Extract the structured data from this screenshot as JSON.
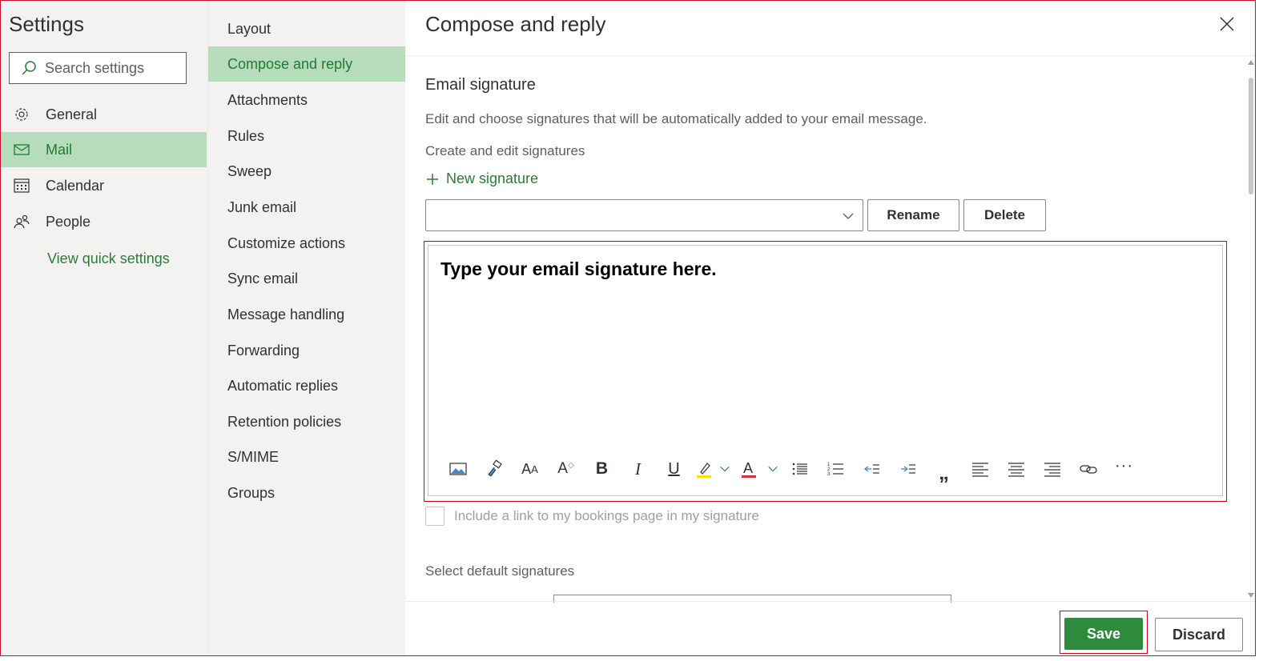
{
  "sidebar": {
    "title": "Settings",
    "search_placeholder": "Search settings",
    "items": [
      {
        "label": "General",
        "icon": "gear-icon"
      },
      {
        "label": "Mail",
        "icon": "mail-icon",
        "active": true
      },
      {
        "label": "Calendar",
        "icon": "calendar-icon"
      },
      {
        "label": "People",
        "icon": "people-icon"
      }
    ],
    "quick_settings": "View quick settings"
  },
  "midnav": {
    "items": [
      {
        "label": "Layout"
      },
      {
        "label": "Compose and reply",
        "active": true
      },
      {
        "label": "Attachments"
      },
      {
        "label": "Rules"
      },
      {
        "label": "Sweep"
      },
      {
        "label": "Junk email"
      },
      {
        "label": "Customize actions"
      },
      {
        "label": "Sync email"
      },
      {
        "label": "Message handling"
      },
      {
        "label": "Forwarding"
      },
      {
        "label": "Automatic replies"
      },
      {
        "label": "Retention policies"
      },
      {
        "label": "S/MIME"
      },
      {
        "label": "Groups"
      }
    ]
  },
  "main": {
    "title": "Compose and reply",
    "section_title": "Email signature",
    "description": "Edit and choose signatures that will be automatically added to your email message.",
    "create_edit_label": "Create and edit signatures",
    "new_signature": "New signature",
    "signature_dropdown_value": "",
    "rename_label": "Rename",
    "delete_label": "Delete",
    "editor_text": "Type your email signature here.",
    "include_bookings": "Include a link to my bookings page in my signature",
    "select_default": "Select default signatures",
    "save_label": "Save",
    "discard_label": "Discard"
  },
  "colors": {
    "accent": "#2e8b3e",
    "active_bg": "#b7dcbc",
    "highlight_marker": "#ffe000",
    "font_color_marker": "#d13438"
  },
  "toolbar_icons": [
    "insert-image-icon",
    "format-painter-icon",
    "font-icon",
    "font-size-icon",
    "bold-icon",
    "italic-icon",
    "underline-icon",
    "highlight-icon",
    "highlight-dropdown-icon",
    "font-color-icon",
    "font-color-dropdown-icon",
    "bullets-icon",
    "numbering-icon",
    "decrease-indent-icon",
    "increase-indent-icon",
    "quote-icon",
    "align-left-icon",
    "align-center-icon",
    "align-right-icon",
    "link-icon",
    "more-options-icon"
  ]
}
